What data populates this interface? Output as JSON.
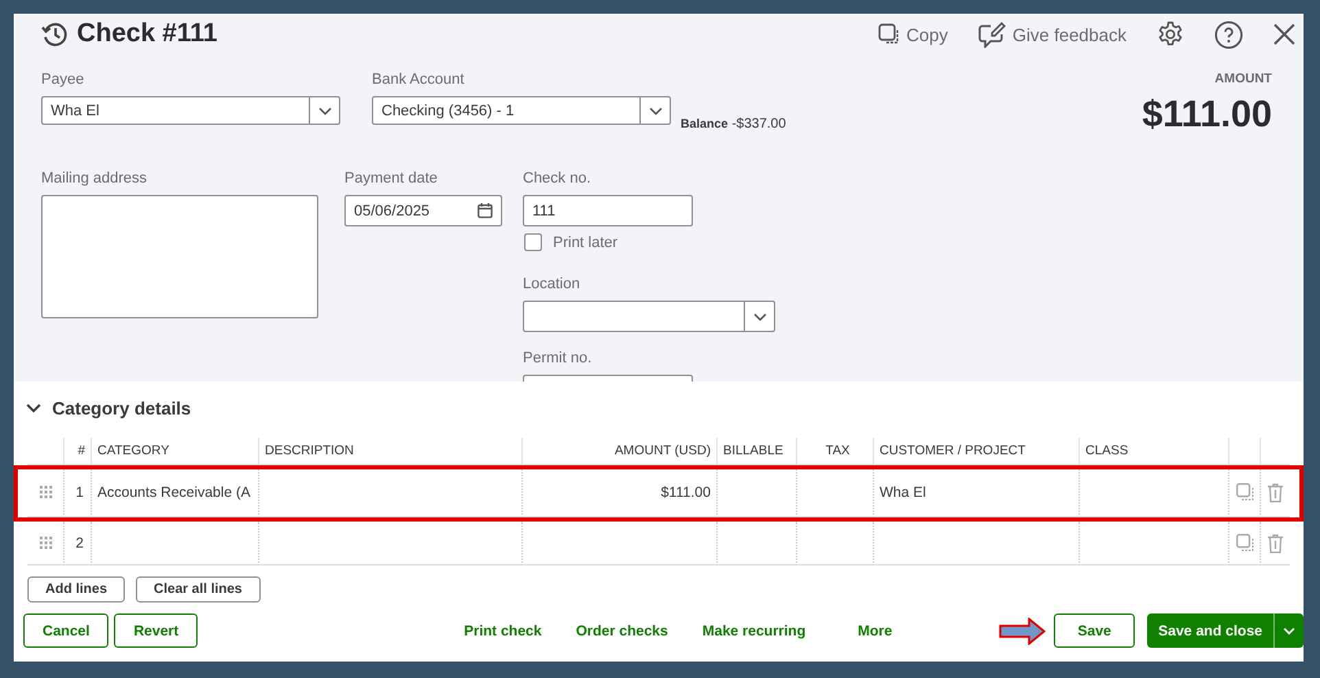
{
  "header": {
    "title": "Check #111",
    "actions": [
      {
        "kind": "copy",
        "label": "Copy"
      },
      {
        "kind": "feedback",
        "label": "Give feedback"
      },
      {
        "kind": "settings"
      },
      {
        "kind": "help"
      },
      {
        "kind": "close"
      }
    ]
  },
  "payee": {
    "label": "Payee",
    "value": "Wha El"
  },
  "bank_account": {
    "label": "Bank Account",
    "value": "Checking (3456) - 1",
    "balance_label": "Balance",
    "balance": "-$337.00"
  },
  "amount": {
    "label": "AMOUNT",
    "value": "$111.00"
  },
  "mailing_address": {
    "label": "Mailing address"
  },
  "payment_date": {
    "label": "Payment date",
    "value": "05/06/2025"
  },
  "check_no": {
    "label": "Check no.",
    "value": "111"
  },
  "print_later": {
    "label": "Print later",
    "checked": false
  },
  "location": {
    "label": "Location"
  },
  "permit_no": {
    "label": "Permit no."
  },
  "category_details": {
    "title": "Category details",
    "expanded": true,
    "columns": [
      "#",
      "CATEGORY",
      "DESCRIPTION",
      "AMOUNT (USD)",
      "BILLABLE",
      "TAX",
      "CUSTOMER / PROJECT",
      "CLASS"
    ],
    "rows": [
      {
        "number": "1",
        "category": "Accounts Receivable (A",
        "description": "",
        "amount": "$111.00",
        "billable": "",
        "tax": "",
        "customer": "Wha El",
        "class": "",
        "highlighted": true
      },
      {
        "number": "2",
        "category": "",
        "description": "",
        "amount": "",
        "billable": "",
        "tax": "",
        "customer": "",
        "class": "",
        "highlighted": false
      }
    ],
    "buttons": [
      "Add lines",
      "Clear all lines"
    ]
  },
  "footer": {
    "left_buttons": [
      "Cancel",
      "Revert"
    ],
    "links": [
      "Print check",
      "Order checks",
      "Make recurring",
      "More"
    ],
    "save": "Save",
    "save_and_close": "Save and close"
  }
}
